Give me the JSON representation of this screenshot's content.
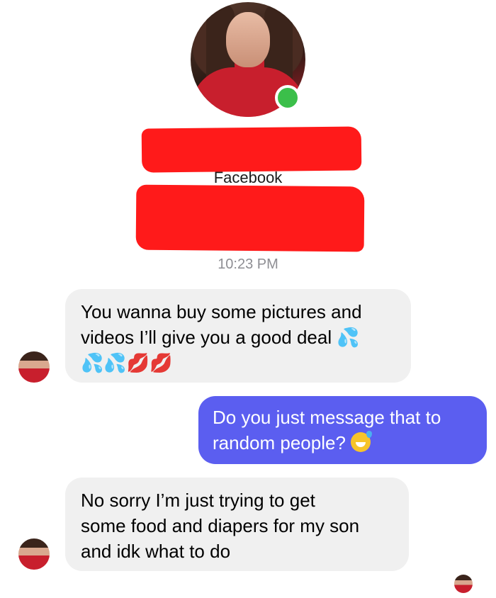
{
  "header": {
    "platform_label": "Facebook",
    "timestamp": "10:23 PM",
    "online_status_color": "#3bbf4a",
    "redaction_color": "#ff1a1a"
  },
  "messages": [
    {
      "direction": "incoming",
      "lines": [
        "You wanna buy some pictures and",
        "videos I’ll give you a good deal"
      ],
      "emoji_tail": "💦",
      "emoji_line": "💦💦💋💋"
    },
    {
      "direction": "outgoing",
      "lines": [
        "Do you just message that to",
        "random people?"
      ],
      "emoji_tail": "😅"
    },
    {
      "direction": "incoming",
      "lines": [
        "No sorry I’m just trying to get",
        "some food and diapers for my son",
        "and idk what to do"
      ]
    }
  ],
  "colors": {
    "incoming_bubble": "#f0f0f0",
    "outgoing_bubble": "#5b5ef0"
  },
  "icons": {
    "online": "online-status-icon",
    "read_receipt": "read-receipt-avatar-icon"
  }
}
